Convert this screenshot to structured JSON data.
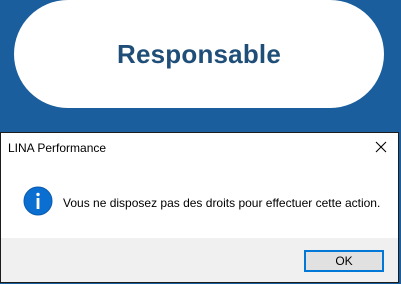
{
  "app": {
    "button_label": "Responsable",
    "background_color": "#1a5e9e",
    "button_text_color": "#1f4e79"
  },
  "dialog": {
    "title": "LINA Performance",
    "message": "Vous ne disposez pas des droits pour effectuer cette action.",
    "icon": "info-icon",
    "icon_color": "#0a6fd0",
    "close_icon": "close-icon",
    "ok_label": "OK",
    "accent_color": "#0078d7"
  }
}
